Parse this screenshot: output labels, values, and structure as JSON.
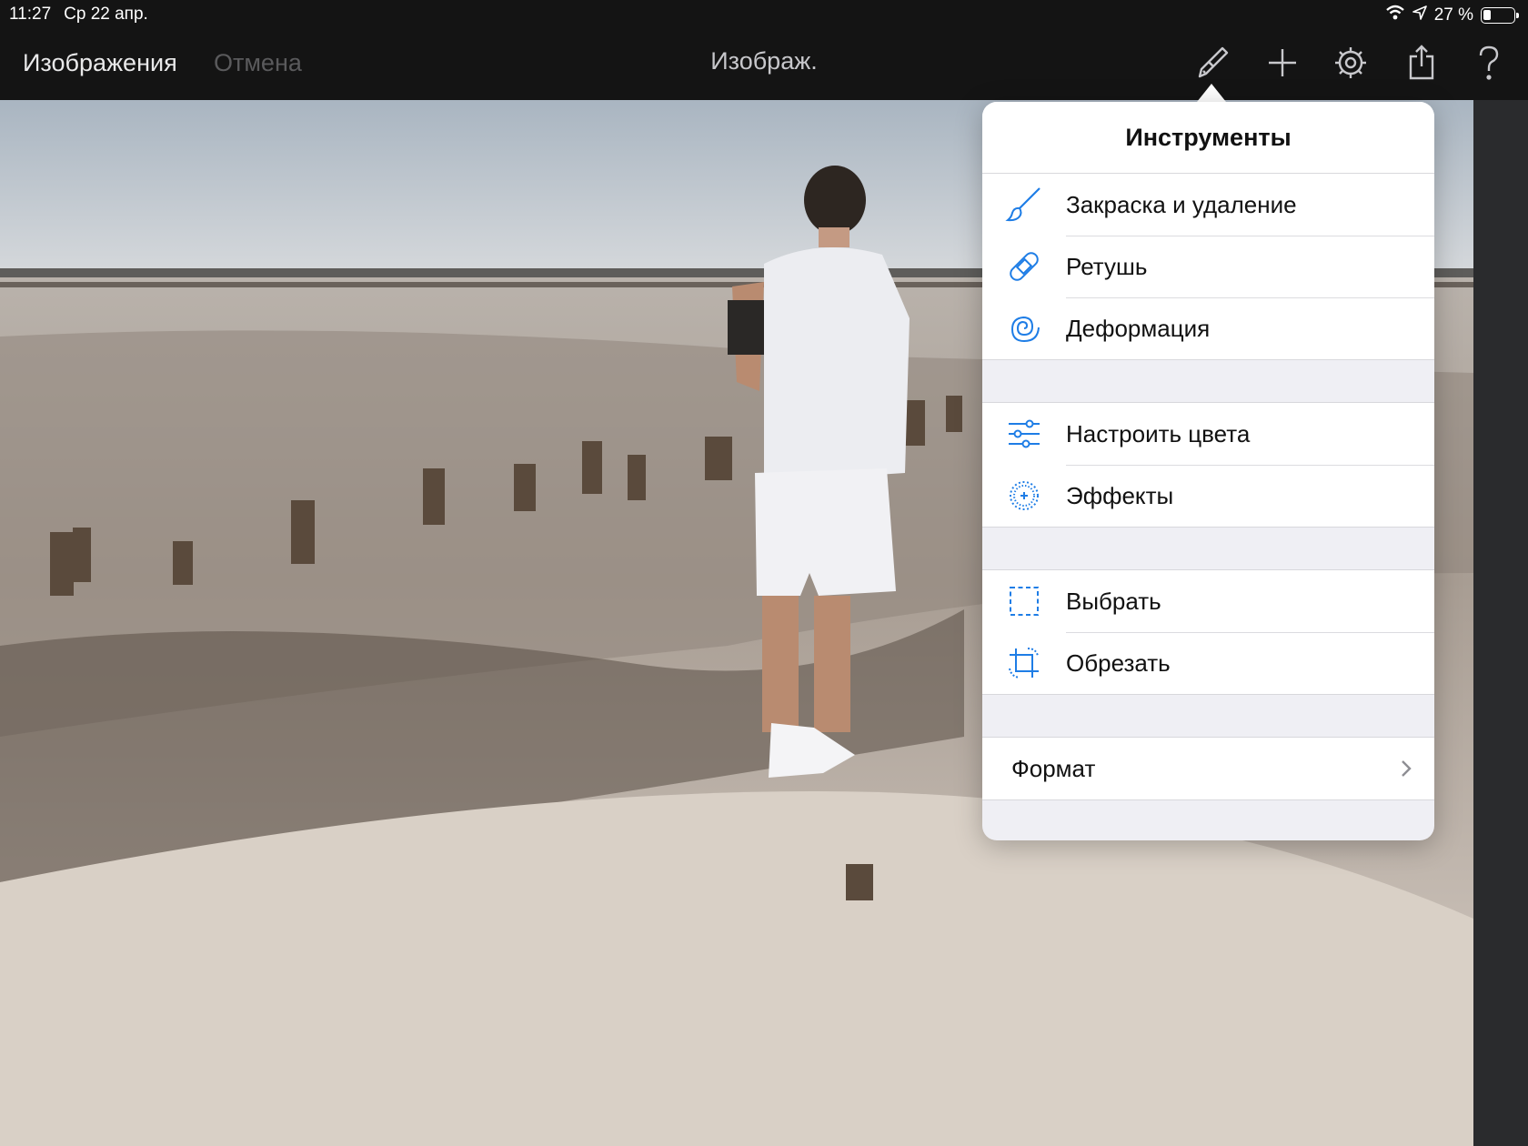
{
  "status_bar": {
    "time": "11:27",
    "date": "Ср 22 апр.",
    "battery_percent": "27 %",
    "battery_level": 0.27,
    "icons": [
      "wifi-icon",
      "location-icon",
      "battery-icon"
    ]
  },
  "nav": {
    "back_label": "Изображения",
    "cancel_label": "Отмена",
    "title": "Изображ.",
    "icons": [
      "paintbrush-tools-icon",
      "plus-icon",
      "gear-icon",
      "share-icon",
      "help-icon"
    ]
  },
  "popover": {
    "title": "Инструменты",
    "groups": [
      {
        "items": [
          {
            "label": "Закраска и удаление",
            "icon": "brush-icon"
          },
          {
            "label": "Ретушь",
            "icon": "bandage-icon"
          },
          {
            "label": "Деформация",
            "icon": "spiral-icon"
          }
        ]
      },
      {
        "items": [
          {
            "label": "Настроить цвета",
            "icon": "sliders-icon"
          },
          {
            "label": "Эффекты",
            "icon": "effects-icon"
          }
        ]
      },
      {
        "items": [
          {
            "label": "Выбрать",
            "icon": "selection-icon"
          },
          {
            "label": "Обрезать",
            "icon": "crop-icon"
          }
        ]
      }
    ],
    "format_label": "Формат"
  },
  "colors": {
    "accent": "#1e7de6",
    "navbar_bg": "#141414",
    "popover_bg": "#ffffff"
  }
}
